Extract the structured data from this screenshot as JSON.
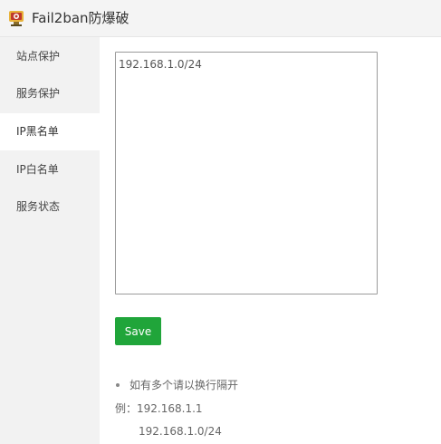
{
  "window": {
    "title": "Fail2ban防爆破",
    "logo_icon": "fail2ban-logo-icon"
  },
  "sidebar": {
    "items": [
      {
        "label": "站点保护",
        "active": false
      },
      {
        "label": "服务保护",
        "active": false
      },
      {
        "label": "IP黑名单",
        "active": true
      },
      {
        "label": "IP白名单",
        "active": false
      },
      {
        "label": "服务状态",
        "active": false
      }
    ]
  },
  "main": {
    "ip_list_value": "192.168.1.0/24",
    "save_label": "Save",
    "help_bullet": "如有多个请以换行隔开",
    "example_prefix": "例：",
    "example_ip_1": "192.168.1.1",
    "example_ip_2": "192.168.1.0/24"
  },
  "colors": {
    "accent": "#20a53a",
    "sidebar_bg": "#f2f2f2",
    "titlebar_bg": "#f4f4f4"
  }
}
